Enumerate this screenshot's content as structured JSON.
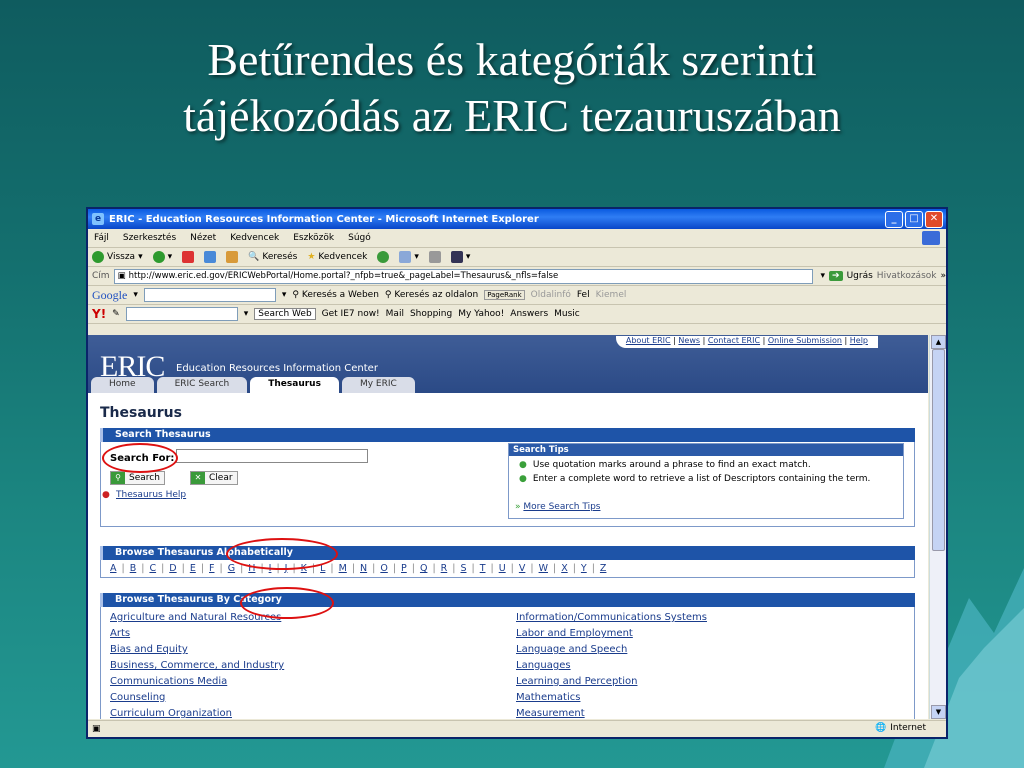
{
  "slide": {
    "title_line1": "Betűrendes és kategóriák szerinti",
    "title_line2": "tájékozódás az ERIC tezauruszában"
  },
  "window": {
    "title": "ERIC - Education Resources Information Center - Microsoft Internet Explorer",
    "menu": [
      "Fájl",
      "Szerkesztés",
      "Nézet",
      "Kedvencek",
      "Eszközök",
      "Súgó"
    ],
    "toolbar": {
      "back": "Vissza",
      "search": "Keresés",
      "favorites": "Kedvencek"
    },
    "address_label": "Cím",
    "address_value": "http://www.eric.ed.gov/ERICWebPortal/Home.portal?_nfpb=true&_pageLabel=Thesaurus&_nfls=false",
    "go_label": "Ugrás",
    "links_label": "Hivatkozások",
    "google": {
      "brand": "Google",
      "search_web": "Keresés a Weben",
      "search_site": "Keresés az oldalon",
      "pagerank": "PageRank",
      "page_info": "Oldalinfó",
      "up": "Fel",
      "highlight": "Kiemel"
    },
    "yahoo": {
      "search_web": "Search Web",
      "get_ie7": "Get IE7 now!",
      "mail": "Mail",
      "shopping": "Shopping",
      "my_yahoo": "My Yahoo!",
      "answers": "Answers",
      "music": "Music"
    },
    "status_zone": "Internet"
  },
  "eric": {
    "top_links": [
      "About ERIC",
      "News",
      "Contact ERIC",
      "Online Submission",
      "Help"
    ],
    "logo": "ERIC",
    "subtitle": "Education Resources Information Center",
    "tabs": [
      "Home",
      "ERIC Search",
      "Thesaurus",
      "My ERIC"
    ],
    "page_title": "Thesaurus",
    "search_section": "Search Thesaurus",
    "search_for_label": "Search For:",
    "search_btn": "Search",
    "clear_btn": "Clear",
    "help_link": "Thesaurus Help",
    "tips_title": "Search Tips",
    "tips": [
      "Use quotation marks around a phrase to find an exact match.",
      "Enter a complete word to retrieve a list of Descriptors containing the term."
    ],
    "more_tips": "More Search Tips",
    "browse_alpha": "Browse Thesaurus Alphabetically",
    "letters": [
      "A",
      "B",
      "C",
      "D",
      "E",
      "F",
      "G",
      "H",
      "I",
      "J",
      "K",
      "L",
      "M",
      "N",
      "O",
      "P",
      "Q",
      "R",
      "S",
      "T",
      "U",
      "V",
      "W",
      "X",
      "Y",
      "Z"
    ],
    "browse_cat": "Browse Thesaurus By Category",
    "categories_left": [
      "Agriculture and Natural Resources",
      "Arts",
      "Bias and Equity",
      "Business, Commerce, and Industry",
      "Communications Media",
      "Counseling",
      "Curriculum Organization"
    ],
    "categories_right": [
      "Information/Communications Systems",
      "Labor and Employment",
      "Language and Speech",
      "Languages",
      "Learning and Perception",
      "Mathematics",
      "Measurement"
    ]
  },
  "colors": {
    "accent": "#1e54a8",
    "annotation": "#dd1111"
  }
}
